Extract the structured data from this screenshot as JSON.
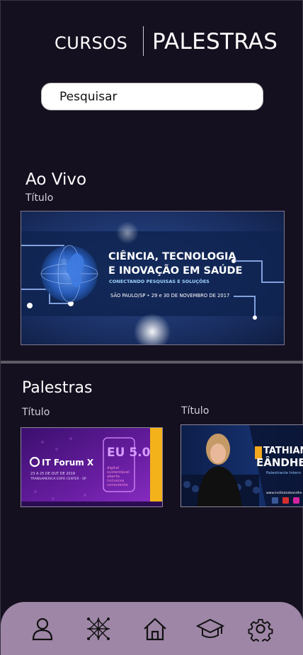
{
  "header": {
    "tab_cursos": "CURSOS",
    "tab_palestras": "PALESTRAS"
  },
  "search": {
    "placeholder": "Pesquisar"
  },
  "live": {
    "heading": "Ao Vivo",
    "caption": "Título",
    "banner": {
      "line1": "CIÊNCIA, TECNOLOGIA",
      "line2": "E INOVAÇÃO EM SAÚDE",
      "subtitle": "CONECTANDO PESQUISAS E SOLUÇÕES",
      "place_date": "SÃO PAULO/SP • 29 e 30 DE NOVEMBRO DE 2017"
    }
  },
  "palestras": {
    "heading": "Palestras",
    "items": [
      {
        "caption": "Título",
        "poster": {
          "brand": "IT Forum X",
          "dates": "23 A 25 DE OUT DE 2019",
          "venue": "TRANSAMERICA EXPO CENTER · SP",
          "badge": "EU 5.0",
          "tag_lines": [
            "digital",
            "sustentável",
            "aberta",
            "inclusiva",
            "consciente"
          ]
        }
      },
      {
        "caption": "Título",
        "poster": {
          "name_line1": "TATHIAN",
          "name_line2": "EÂNDHE",
          "role": "Palestrante Intern",
          "site": "www.institutodeandhe"
        }
      }
    ]
  },
  "bottom_nav": {
    "items": [
      "profile-icon",
      "network-icon",
      "home-icon",
      "graduation-cap-icon",
      "settings-icon"
    ]
  },
  "colors": {
    "background": "#15101f",
    "nav": "#9e86a6",
    "banner_blue": "#0d2350",
    "purple": "#5a1a8e"
  }
}
